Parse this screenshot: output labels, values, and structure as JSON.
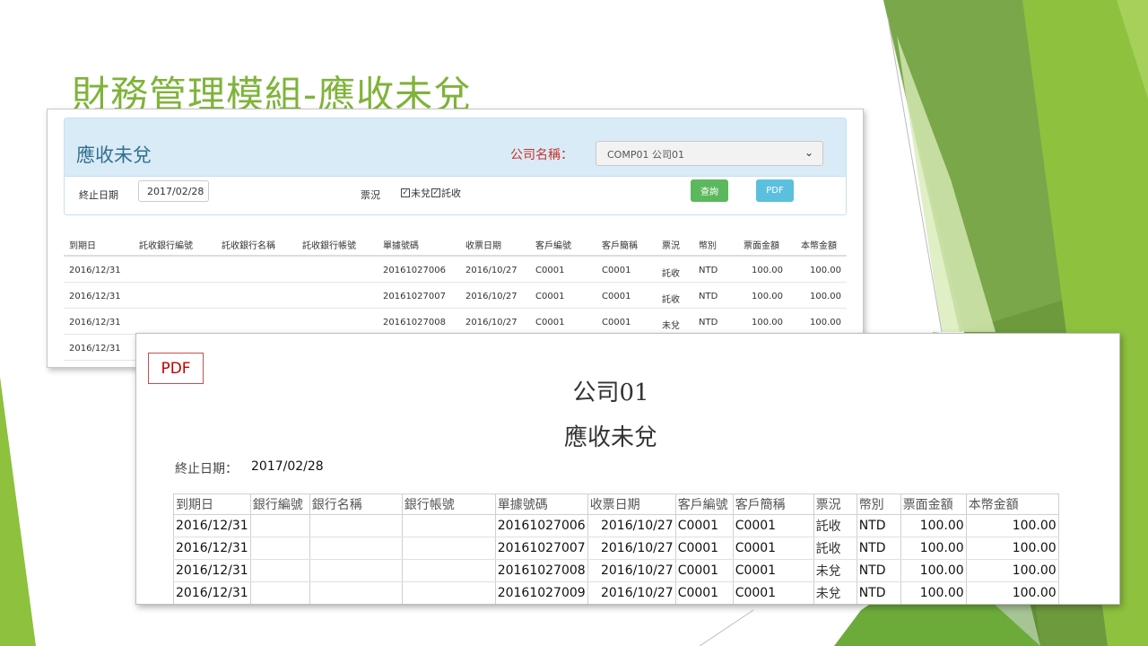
{
  "slide": {
    "title": "財務管理模組-應收未兌"
  },
  "colors": {
    "accent_green": "#7fb33a",
    "panel_blue": "#d9ebf6",
    "label_red": "#c9302c",
    "btn_query": "#5cb85c",
    "btn_pdf": "#5bc0de"
  },
  "web": {
    "panel_title": "應收未兌",
    "company_label": "公司名稱：",
    "company_value": "COMP01 公司01",
    "end_date_label": "終止日期",
    "end_date_value": "2017/02/28",
    "status_label": "票況",
    "cb_uncashed": "未兌",
    "cb_collection": "託收",
    "query_button": "查詢",
    "pdf_button": "PDF",
    "columns": [
      "到期日",
      "託收銀行編號",
      "託收銀行名稱",
      "託收銀行帳號",
      "單據號碼",
      "收票日期",
      "客戶編號",
      "客戶簡稱",
      "票況",
      "幣別",
      "票面金額",
      "本幣金額"
    ],
    "rows": [
      [
        "2016/12/31",
        "",
        "",
        "",
        "20161027006",
        "2016/10/27",
        "C0001",
        "C0001",
        "託收",
        "NTD",
        "100.00",
        "100.00"
      ],
      [
        "2016/12/31",
        "",
        "",
        "",
        "20161027007",
        "2016/10/27",
        "C0001",
        "C0001",
        "託收",
        "NTD",
        "100.00",
        "100.00"
      ],
      [
        "2016/12/31",
        "",
        "",
        "",
        "20161027008",
        "2016/10/27",
        "C0001",
        "C0001",
        "未兌",
        "NTD",
        "100.00",
        "100.00"
      ],
      [
        "2016/12/31",
        "",
        "",
        "",
        "",
        "",
        "",
        "",
        "",
        "",
        "",
        ""
      ]
    ]
  },
  "pdf": {
    "tag": "PDF",
    "company": "公司01",
    "title": "應收未兌",
    "end_date_label": "終止日期：",
    "end_date_value": "2017/02/28",
    "columns": [
      "到期日",
      "銀行編號",
      "銀行名稱",
      "銀行帳號",
      "單據號碼",
      "收票日期",
      "客戶編號",
      "客戶簡稱",
      "票況",
      "幣別",
      "票面金額",
      "本幣金額"
    ],
    "rows": [
      [
        "2016/12/31",
        "",
        "",
        "",
        "20161027006",
        "2016/10/27",
        "C0001",
        "C0001",
        "託收",
        "NTD",
        "100.00",
        "100.00"
      ],
      [
        "2016/12/31",
        "",
        "",
        "",
        "20161027007",
        "2016/10/27",
        "C0001",
        "C0001",
        "託收",
        "NTD",
        "100.00",
        "100.00"
      ],
      [
        "2016/12/31",
        "",
        "",
        "",
        "20161027008",
        "2016/10/27",
        "C0001",
        "C0001",
        "未兌",
        "NTD",
        "100.00",
        "100.00"
      ],
      [
        "2016/12/31",
        "",
        "",
        "",
        "20161027009",
        "2016/10/27",
        "C0001",
        "C0001",
        "未兌",
        "NTD",
        "100.00",
        "100.00"
      ]
    ]
  }
}
